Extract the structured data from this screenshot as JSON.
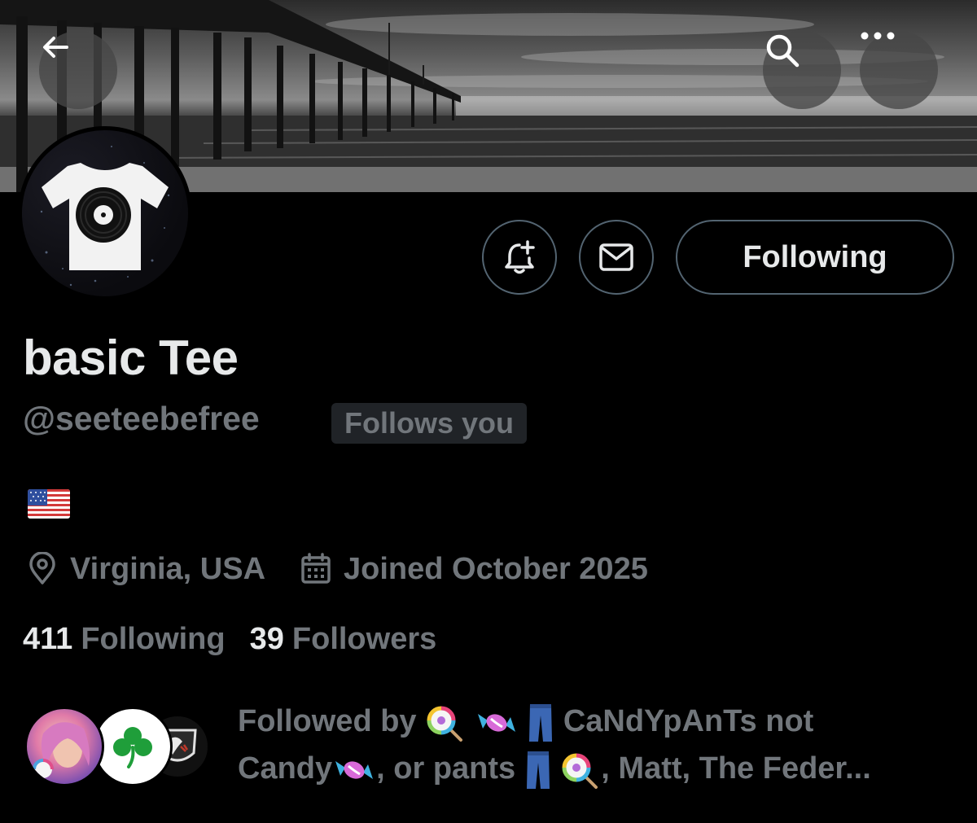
{
  "header": {
    "back_icon": "arrow-left-icon",
    "search_icon": "search-icon",
    "more_icon": "more-dots-icon"
  },
  "profile": {
    "display_name": "basic Tee",
    "handle": "@seeteebefree",
    "follows_you_badge": "Follows you",
    "bio_flag": "us-flag-emoji",
    "location": "Virginia, USA",
    "joined": "Joined October 2025"
  },
  "actions": {
    "notify_icon": "bell-plus-icon",
    "message_icon": "envelope-icon",
    "following_label": "Following"
  },
  "stats": {
    "following_count": "411",
    "following_label": "Following",
    "followers_count": "39",
    "followers_label": "Followers"
  },
  "followed_by": {
    "prefix": "Followed by",
    "name1_part1": "CaNdYpAnTs not",
    "name1_part2": "Candy",
    "name1_part3": ", or pants",
    "rest": ", Matt, The Feder..."
  },
  "colors": {
    "background": "#000000",
    "text_primary": "#e7e9ea",
    "text_secondary": "#71767b",
    "border": "#536471",
    "badge_bg": "#202327"
  }
}
